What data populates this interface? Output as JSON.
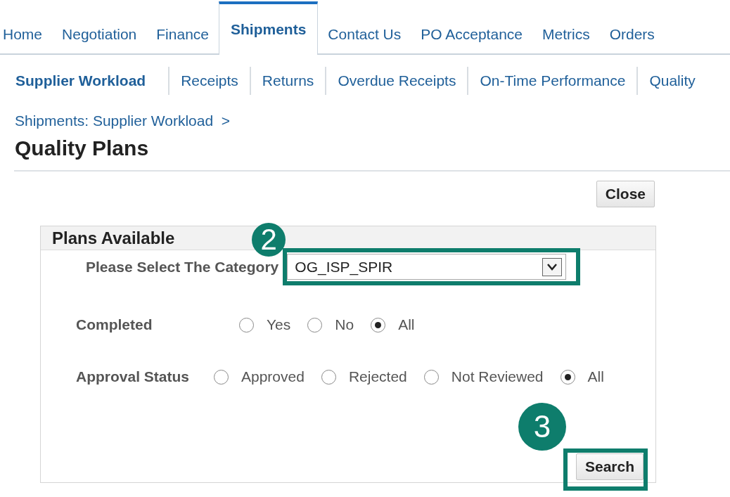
{
  "tabs": [
    {
      "label": "Home",
      "selected": false
    },
    {
      "label": "Negotiation",
      "selected": false
    },
    {
      "label": "Finance",
      "selected": false
    },
    {
      "label": "Shipments",
      "selected": true
    },
    {
      "label": "Contact Us",
      "selected": false
    },
    {
      "label": "PO Acceptance",
      "selected": false
    },
    {
      "label": "Metrics",
      "selected": false
    },
    {
      "label": "Orders",
      "selected": false
    }
  ],
  "subtabs": [
    {
      "label": "Supplier Workload",
      "selected": true
    },
    {
      "label": "Receipts",
      "selected": false
    },
    {
      "label": "Returns",
      "selected": false
    },
    {
      "label": "Overdue Receipts",
      "selected": false
    },
    {
      "label": "On-Time Performance",
      "selected": false
    },
    {
      "label": "Quality",
      "selected": false
    }
  ],
  "breadcrumb": "Shipments: Supplier Workload  >",
  "title": "Quality Plans",
  "close_button": "Close",
  "panel": {
    "title": "Plans Available",
    "category": {
      "label": "Please Select The Category",
      "value": "OG_ISP_SPIR",
      "callout": "2"
    },
    "radio_groups": [
      {
        "label": "Completed",
        "options": [
          {
            "label": "Yes",
            "selected": false
          },
          {
            "label": "No",
            "selected": false
          },
          {
            "label": "All",
            "selected": true
          }
        ]
      },
      {
        "label": "Approval Status",
        "options": [
          {
            "label": "Approved",
            "selected": false
          },
          {
            "label": "Rejected",
            "selected": false
          },
          {
            "label": "Not Reviewed",
            "selected": false
          },
          {
            "label": "All",
            "selected": true
          }
        ]
      }
    ],
    "search_button": {
      "label": "Search",
      "callout": "3"
    }
  }
}
